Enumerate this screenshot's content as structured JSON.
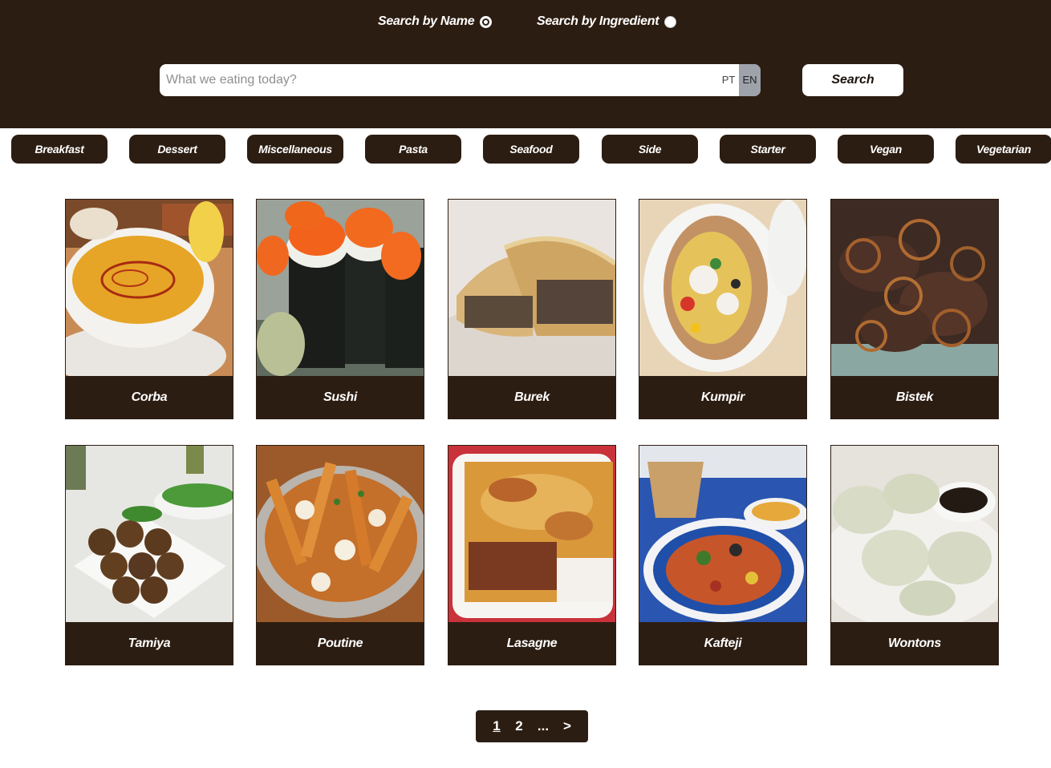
{
  "search_mode": {
    "by_name_label": "Search by Name",
    "by_ingredient_label": "Search by Ingredient",
    "selected": "by_name"
  },
  "search": {
    "placeholder": "What we eating today?",
    "value": "",
    "lang_pt": "PT",
    "lang_en": "EN",
    "active_lang": "EN",
    "button_label": "Search"
  },
  "categories": [
    "Breakfast",
    "Dessert",
    "Miscellaneous",
    "Pasta",
    "Seafood",
    "Side",
    "Starter",
    "Vegan",
    "Vegetarian"
  ],
  "meals": [
    {
      "name": "Corba"
    },
    {
      "name": "Sushi"
    },
    {
      "name": "Burek"
    },
    {
      "name": "Kumpir"
    },
    {
      "name": "Bistek"
    },
    {
      "name": "Tamiya"
    },
    {
      "name": "Poutine"
    },
    {
      "name": "Lasagne"
    },
    {
      "name": "Kafteji"
    },
    {
      "name": "Wontons"
    }
  ],
  "pagination": {
    "pages": [
      "1",
      "2"
    ],
    "current": "1",
    "ellipsis": "...",
    "next": ">"
  },
  "colors": {
    "brand_dark": "#2c1d12",
    "background": "#ffffff"
  }
}
